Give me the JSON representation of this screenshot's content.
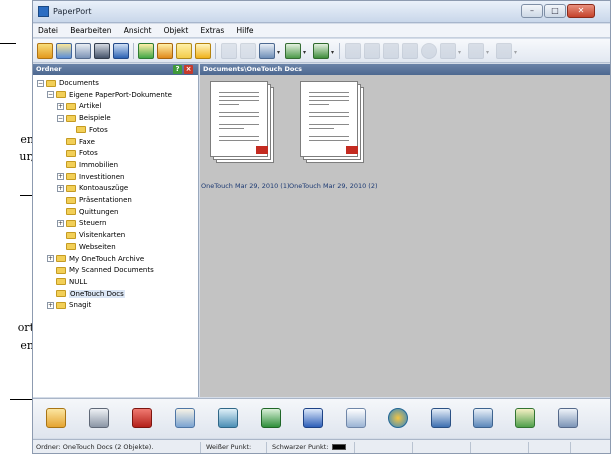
{
  "callouts": {
    "frag1": "en",
    "frag2": "ur,",
    "frag3": "ort",
    "frag4": "en"
  },
  "window": {
    "title": "PaperPort",
    "minimize": "–",
    "maximize": "□",
    "close": "✕"
  },
  "menu": [
    "Datei",
    "Bearbeiten",
    "Ansicht",
    "Objekt",
    "Extras",
    "Hilfe"
  ],
  "folder_pane": {
    "header": "Ordner",
    "tree": [
      {
        "label": "Documents",
        "level": 0,
        "expander": "−"
      },
      {
        "label": "Eigene PaperPort-Dokumente",
        "level": 1,
        "expander": "−"
      },
      {
        "label": "Artikel",
        "level": 2,
        "expander": "+"
      },
      {
        "label": "Beispiele",
        "level": 2,
        "expander": "−"
      },
      {
        "label": "Fotos",
        "level": 3,
        "expander": ""
      },
      {
        "label": "Faxe",
        "level": 2,
        "expander": ""
      },
      {
        "label": "Fotos",
        "level": 2,
        "expander": ""
      },
      {
        "label": "Immobilien",
        "level": 2,
        "expander": ""
      },
      {
        "label": "Investitionen",
        "level": 2,
        "expander": "+"
      },
      {
        "label": "Kontoauszüge",
        "level": 2,
        "expander": "+"
      },
      {
        "label": "Präsentationen",
        "level": 2,
        "expander": ""
      },
      {
        "label": "Quittungen",
        "level": 2,
        "expander": ""
      },
      {
        "label": "Steuern",
        "level": 2,
        "expander": "+"
      },
      {
        "label": "Visitenkarten",
        "level": 2,
        "expander": ""
      },
      {
        "label": "Webseiten",
        "level": 2,
        "expander": ""
      },
      {
        "label": "My OneTouch Archive",
        "level": 1,
        "expander": "+"
      },
      {
        "label": "My Scanned Documents",
        "level": 1,
        "expander": ""
      },
      {
        "label": "NULL",
        "level": 1,
        "expander": ""
      },
      {
        "label": "OneTouch Docs",
        "level": 1,
        "expander": "",
        "selected": true
      },
      {
        "label": "Snagit",
        "level": 1,
        "expander": "+"
      }
    ]
  },
  "doc_pane": {
    "header": "Documents\\OneTouch Docs",
    "items": [
      {
        "caption": "OneTouch Mar 29, 2010 (1)"
      },
      {
        "caption": "OneTouch Mar 29, 2010 (2)"
      }
    ]
  },
  "sendto_apps": [
    "photo-viewer-icon",
    "scanner-icon",
    "pdf-icon",
    "paint-icon",
    "eraser-icon",
    "excel-icon",
    "word-icon",
    "notepad-icon",
    "browser-icon",
    "ftp-icon",
    "printer-icon",
    "recycle-icon",
    "copy-icon"
  ],
  "status": {
    "folder": "Ordner: OneTouch Docs (2 Objekte).",
    "white_point": "Weißer Punkt:",
    "black_point": "Schwarzer Punkt:"
  },
  "colors": {
    "pane_header": "#4d6890",
    "doc_background": "#c3c3c3",
    "caption": "#1d3a73"
  }
}
